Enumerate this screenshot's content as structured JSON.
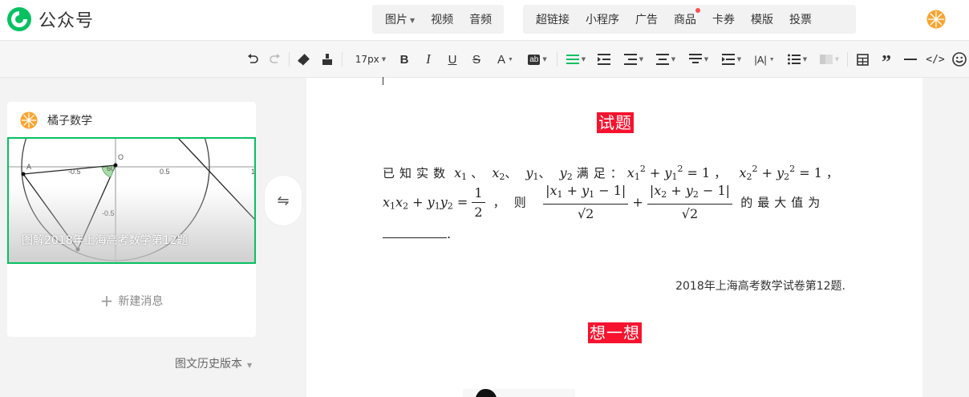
{
  "brand": {
    "name": "公众号",
    "color": "#07c160"
  },
  "top_menu": {
    "group1": [
      {
        "label": "图片",
        "has_caret": true
      },
      {
        "label": "视频"
      },
      {
        "label": "音频"
      }
    ],
    "group2": [
      {
        "label": "超链接"
      },
      {
        "label": "小程序"
      },
      {
        "label": "广告"
      },
      {
        "label": "商品",
        "badge": true
      },
      {
        "label": "卡券"
      },
      {
        "label": "模版"
      },
      {
        "label": "投票"
      }
    ]
  },
  "toolbar": {
    "font_size": "17px",
    "icons": [
      "undo-icon",
      "redo-icon",
      "eraser-icon",
      "format-painter-icon",
      "font-size-select",
      "bold-icon",
      "italic-icon",
      "underline-icon",
      "strikethrough-icon",
      "font-color-icon",
      "background-color-icon",
      "align-left-icon",
      "indent-icon",
      "first-line-indent-icon",
      "line-spacing-icon",
      "paragraph-spacing-icon",
      "letter-spacing-icon",
      "margin-icon",
      "list-icon",
      "disabled-icon",
      "table-icon",
      "quote-icon",
      "divider-icon",
      "code-icon",
      "emoji-icon"
    ]
  },
  "left_panel": {
    "account_name": "橘子数学",
    "thumbnail_caption": "图解2018年上海高考数学第12题",
    "new_message": "新建消息",
    "history_version": "图文历史版本"
  },
  "editor": {
    "section1_title": "试题",
    "problem": {
      "given": "已知实数",
      "sep": "、",
      "satisfy": "满足：",
      "comma": "，",
      "then": "则",
      "max_value": "的最大值为",
      "end": "."
    },
    "source": "2018年上海高考数学试卷第12题.",
    "section2_title": "想一想"
  },
  "colors": {
    "accent": "#07c160",
    "tag_red": "#f7132e",
    "badge_red": "#fa5151"
  }
}
